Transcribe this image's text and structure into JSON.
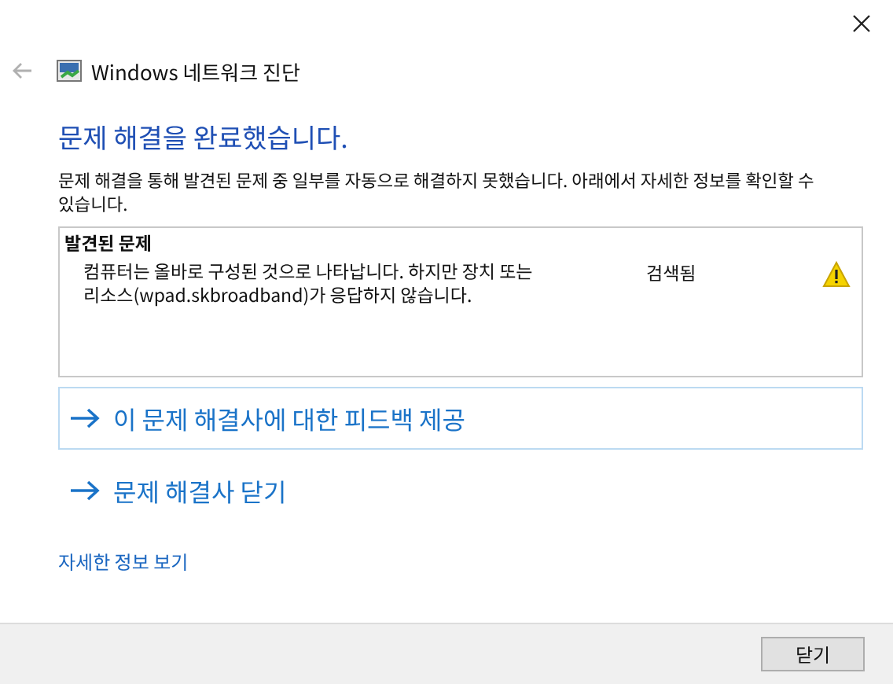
{
  "window": {
    "title": "Windows 네트워크 진단"
  },
  "heading": "문제 해결을 완료했습니다.",
  "description": "문제 해결을 통해 발견된 문제 중 일부를 자동으로 해결하지 못했습니다. 아래에서 자세한 정보를 확인할 수 있습니다.",
  "problems_panel": {
    "title": "발견된 문제",
    "items": [
      {
        "description": "컴퓨터는 올바로 구성된 것으로 나타납니다. 하지만 장치 또는 리소스(wpad.skbroadband)가 응답하지 않습니다.",
        "status": "검색됨",
        "kind": "warning"
      }
    ]
  },
  "actions": [
    {
      "label": "이 문제 해결사에 대한 피드백 제공",
      "focused": true
    },
    {
      "label": "문제 해결사 닫기",
      "focused": false
    }
  ],
  "details_link": "자세한 정보 보기",
  "buttons": [
    "닫기"
  ]
}
